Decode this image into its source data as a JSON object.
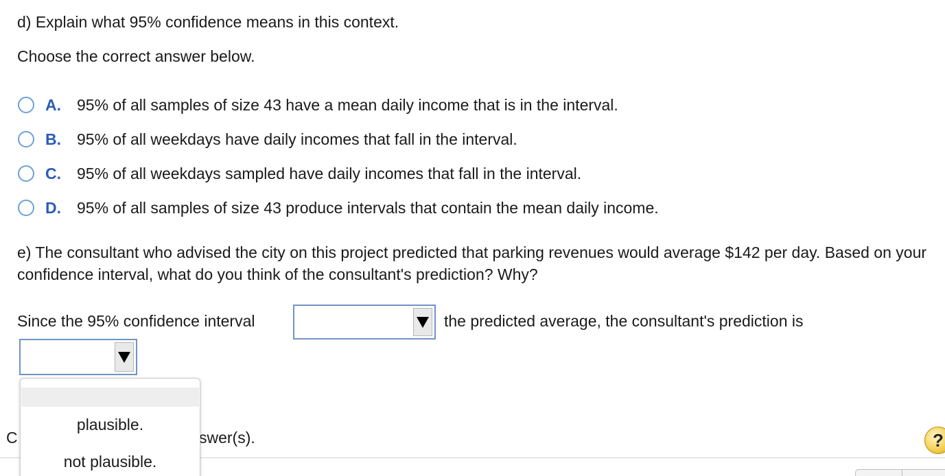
{
  "part_d": {
    "question": "d) Explain what 95% confidence means in this context.",
    "instruction": "Choose the correct answer below.",
    "choices": [
      {
        "letter": "A.",
        "text": "95% of all samples of size 43 have a mean daily income that is in the interval."
      },
      {
        "letter": "B.",
        "text": "95% of all weekdays have daily incomes that fall in the interval."
      },
      {
        "letter": "C.",
        "text": "95% of all weekdays sampled have daily incomes that fall in the interval."
      },
      {
        "letter": "D.",
        "text": "95% of all samples of size 43 produce intervals that contain the mean daily income."
      }
    ]
  },
  "part_e": {
    "question": "e) The consultant who advised the city on this project predicted that parking revenues would average $142 per day. Based on your confidence interval, what do you think of the consultant's prediction? Why?",
    "sentence_start": "Since the 95% confidence interval",
    "sentence_middle": "the predicted average, the consultant's prediction is",
    "dropdown1_value": "",
    "dropdown2_value": ""
  },
  "menu": {
    "options": [
      "plausible.",
      "not plausible."
    ]
  },
  "footer": {
    "partial_left": "C",
    "partial_text": "swer(s).",
    "help_label": "?"
  },
  "colors": {
    "choice_letter": "#2b5cb8",
    "radio_border": "#6e9fd8",
    "dropdown_border": "#6e93c9",
    "help_button": "#f2cf53"
  }
}
